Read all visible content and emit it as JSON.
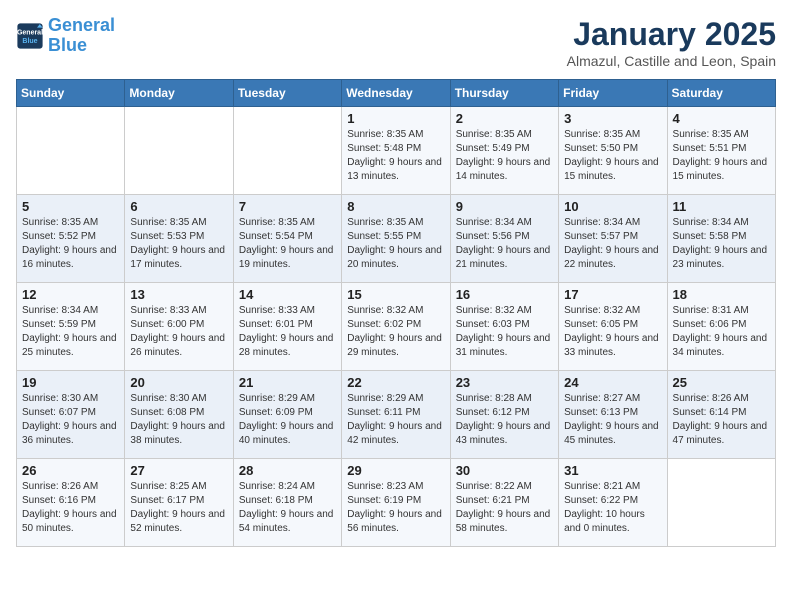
{
  "header": {
    "logo_line1": "General",
    "logo_line2": "Blue",
    "title": "January 2025",
    "subtitle": "Almazul, Castille and Leon, Spain"
  },
  "days_of_week": [
    "Sunday",
    "Monday",
    "Tuesday",
    "Wednesday",
    "Thursday",
    "Friday",
    "Saturday"
  ],
  "weeks": [
    [
      {
        "day": "",
        "sunrise": "",
        "sunset": "",
        "daylight": ""
      },
      {
        "day": "",
        "sunrise": "",
        "sunset": "",
        "daylight": ""
      },
      {
        "day": "",
        "sunrise": "",
        "sunset": "",
        "daylight": ""
      },
      {
        "day": "1",
        "sunrise": "8:35 AM",
        "sunset": "5:48 PM",
        "daylight": "9 hours and 13 minutes."
      },
      {
        "day": "2",
        "sunrise": "8:35 AM",
        "sunset": "5:49 PM",
        "daylight": "9 hours and 14 minutes."
      },
      {
        "day": "3",
        "sunrise": "8:35 AM",
        "sunset": "5:50 PM",
        "daylight": "9 hours and 15 minutes."
      },
      {
        "day": "4",
        "sunrise": "8:35 AM",
        "sunset": "5:51 PM",
        "daylight": "9 hours and 15 minutes."
      }
    ],
    [
      {
        "day": "5",
        "sunrise": "8:35 AM",
        "sunset": "5:52 PM",
        "daylight": "9 hours and 16 minutes."
      },
      {
        "day": "6",
        "sunrise": "8:35 AM",
        "sunset": "5:53 PM",
        "daylight": "9 hours and 17 minutes."
      },
      {
        "day": "7",
        "sunrise": "8:35 AM",
        "sunset": "5:54 PM",
        "daylight": "9 hours and 19 minutes."
      },
      {
        "day": "8",
        "sunrise": "8:35 AM",
        "sunset": "5:55 PM",
        "daylight": "9 hours and 20 minutes."
      },
      {
        "day": "9",
        "sunrise": "8:34 AM",
        "sunset": "5:56 PM",
        "daylight": "9 hours and 21 minutes."
      },
      {
        "day": "10",
        "sunrise": "8:34 AM",
        "sunset": "5:57 PM",
        "daylight": "9 hours and 22 minutes."
      },
      {
        "day": "11",
        "sunrise": "8:34 AM",
        "sunset": "5:58 PM",
        "daylight": "9 hours and 23 minutes."
      }
    ],
    [
      {
        "day": "12",
        "sunrise": "8:34 AM",
        "sunset": "5:59 PM",
        "daylight": "9 hours and 25 minutes."
      },
      {
        "day": "13",
        "sunrise": "8:33 AM",
        "sunset": "6:00 PM",
        "daylight": "9 hours and 26 minutes."
      },
      {
        "day": "14",
        "sunrise": "8:33 AM",
        "sunset": "6:01 PM",
        "daylight": "9 hours and 28 minutes."
      },
      {
        "day": "15",
        "sunrise": "8:32 AM",
        "sunset": "6:02 PM",
        "daylight": "9 hours and 29 minutes."
      },
      {
        "day": "16",
        "sunrise": "8:32 AM",
        "sunset": "6:03 PM",
        "daylight": "9 hours and 31 minutes."
      },
      {
        "day": "17",
        "sunrise": "8:32 AM",
        "sunset": "6:05 PM",
        "daylight": "9 hours and 33 minutes."
      },
      {
        "day": "18",
        "sunrise": "8:31 AM",
        "sunset": "6:06 PM",
        "daylight": "9 hours and 34 minutes."
      }
    ],
    [
      {
        "day": "19",
        "sunrise": "8:30 AM",
        "sunset": "6:07 PM",
        "daylight": "9 hours and 36 minutes."
      },
      {
        "day": "20",
        "sunrise": "8:30 AM",
        "sunset": "6:08 PM",
        "daylight": "9 hours and 38 minutes."
      },
      {
        "day": "21",
        "sunrise": "8:29 AM",
        "sunset": "6:09 PM",
        "daylight": "9 hours and 40 minutes."
      },
      {
        "day": "22",
        "sunrise": "8:29 AM",
        "sunset": "6:11 PM",
        "daylight": "9 hours and 42 minutes."
      },
      {
        "day": "23",
        "sunrise": "8:28 AM",
        "sunset": "6:12 PM",
        "daylight": "9 hours and 43 minutes."
      },
      {
        "day": "24",
        "sunrise": "8:27 AM",
        "sunset": "6:13 PM",
        "daylight": "9 hours and 45 minutes."
      },
      {
        "day": "25",
        "sunrise": "8:26 AM",
        "sunset": "6:14 PM",
        "daylight": "9 hours and 47 minutes."
      }
    ],
    [
      {
        "day": "26",
        "sunrise": "8:26 AM",
        "sunset": "6:16 PM",
        "daylight": "9 hours and 50 minutes."
      },
      {
        "day": "27",
        "sunrise": "8:25 AM",
        "sunset": "6:17 PM",
        "daylight": "9 hours and 52 minutes."
      },
      {
        "day": "28",
        "sunrise": "8:24 AM",
        "sunset": "6:18 PM",
        "daylight": "9 hours and 54 minutes."
      },
      {
        "day": "29",
        "sunrise": "8:23 AM",
        "sunset": "6:19 PM",
        "daylight": "9 hours and 56 minutes."
      },
      {
        "day": "30",
        "sunrise": "8:22 AM",
        "sunset": "6:21 PM",
        "daylight": "9 hours and 58 minutes."
      },
      {
        "day": "31",
        "sunrise": "8:21 AM",
        "sunset": "6:22 PM",
        "daylight": "10 hours and 0 minutes."
      },
      {
        "day": "",
        "sunrise": "",
        "sunset": "",
        "daylight": ""
      }
    ]
  ]
}
